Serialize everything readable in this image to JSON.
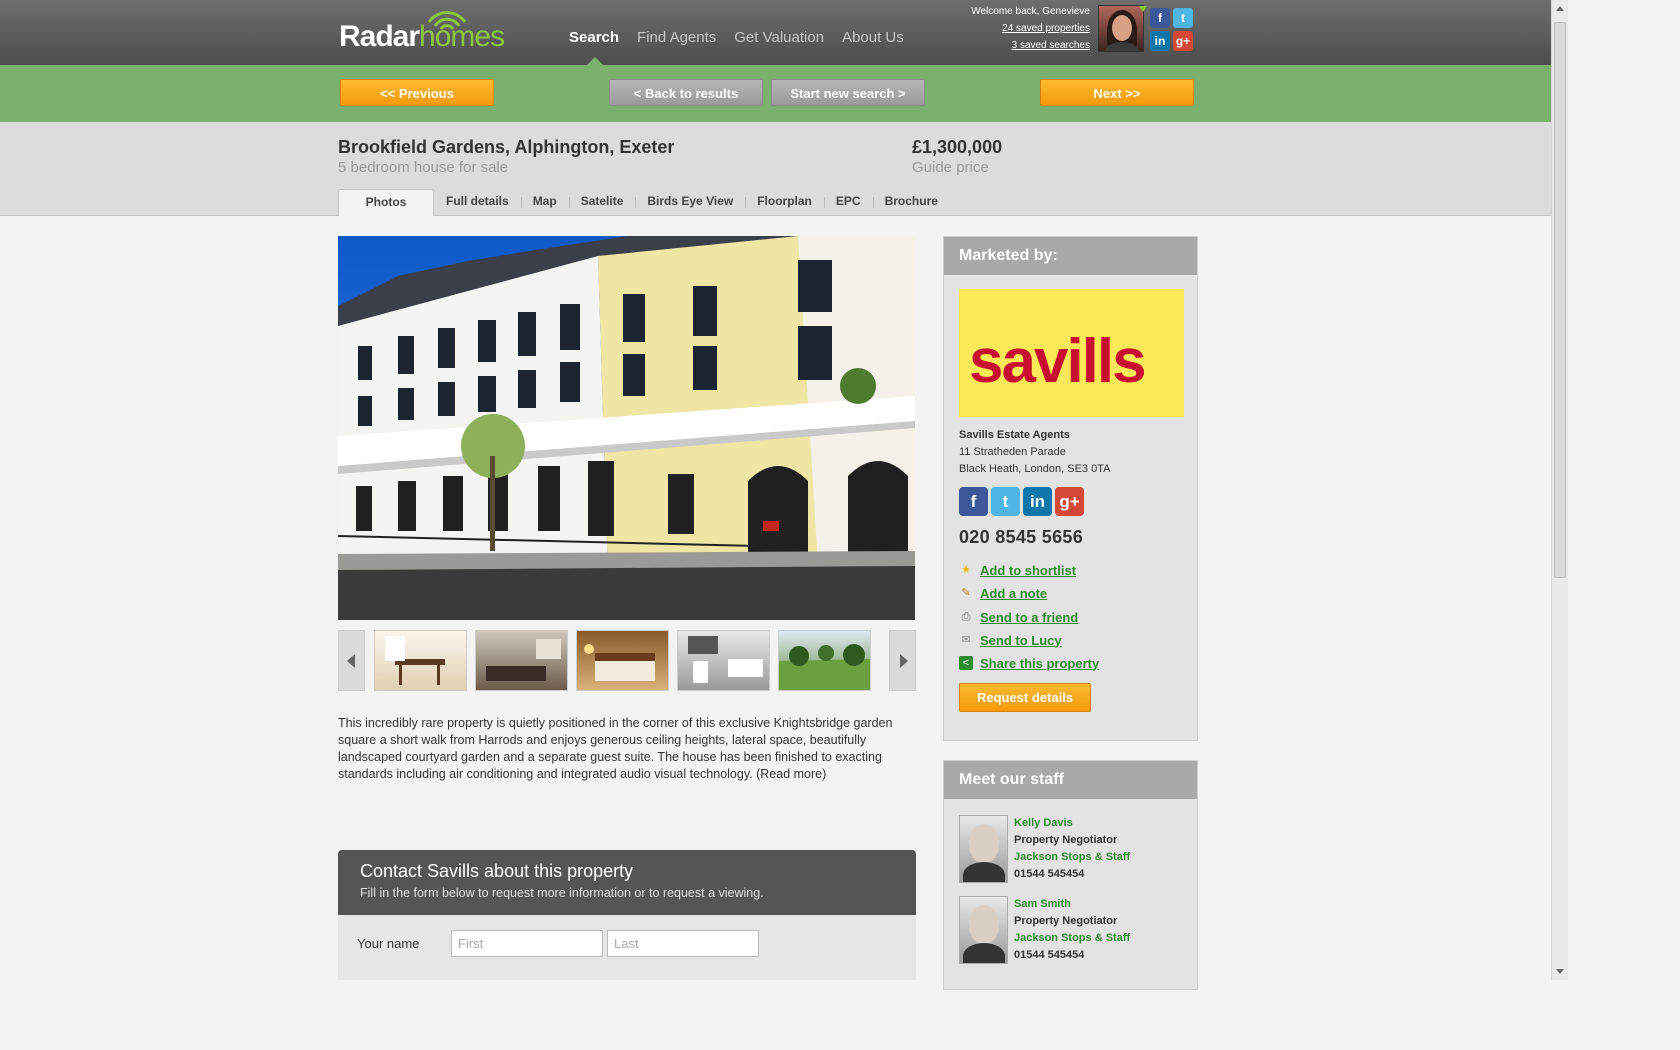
{
  "header": {
    "logo_part1": "Radar",
    "logo_part2": "homes",
    "nav": [
      "Search",
      "Find Agents",
      "Get Valuation",
      "About Us"
    ],
    "welcome": "Welcome back, Genevieve",
    "saved_properties": "24 saved properties",
    "saved_searches": "3 saved searches",
    "social_icons": [
      "facebook-icon",
      "twitter-icon",
      "linkedin-icon",
      "googleplus-icon"
    ]
  },
  "actionbar": {
    "previous": "<< Previous",
    "back_to_results": "< Back to results",
    "start_new_search": "Start new search >",
    "next": "Next >>"
  },
  "property": {
    "title": "Brookfield Gardens, Alphington, Exeter",
    "subtitle": "5 bedroom house for sale",
    "price": "£1,300,000",
    "price_label": "Guide price",
    "tabs": [
      "Photos",
      "Full details",
      "Map",
      "Satelite",
      "Birds Eye View",
      "Floorplan",
      "EPC",
      "Brochure"
    ],
    "description": "This incredibly rare property is quietly positioned in the corner of this exclusive Knightsbridge garden square a short walk from Harrods and enjoys generous ceiling heights, lateral space, beautifully landscaped courtyard garden and a separate guest suite. The house has been finished to exacting standards including air conditioning and integrated audio visual technology. (Read more)"
  },
  "contact": {
    "heading": "Contact Savills about this property",
    "subheading": "Fill in the form below to request more information or to request a viewing.",
    "name_label": "Your name",
    "first_placeholder": "First",
    "last_placeholder": "Last"
  },
  "agent": {
    "panel_title": "Marketed by:",
    "logo_text": "savills",
    "name": "Savills Estate Agents",
    "address1": "11 Stratheden Parade",
    "address2": "Black Heath, London, SE3 0TA",
    "phone": "020 8545 5656",
    "actions": [
      "Add to shortlist",
      "Add a note",
      "Send to a friend",
      "Send to Lucy",
      "Share this property"
    ],
    "request_button": "Request details"
  },
  "staff": {
    "panel_title": "Meet our staff",
    "members": [
      {
        "name": "Kelly Davis",
        "role": "Property Negotiator",
        "company": "Jackson Stops & Staff",
        "phone": "01544 545454"
      },
      {
        "name": "Sam Smith",
        "role": "Property Negotiator",
        "company": "Jackson Stops & Staff",
        "phone": "01544 545454"
      }
    ]
  },
  "colors": {
    "green_bar": "#7bb16e",
    "orange_button": "#f5a414",
    "link_green": "#2e8b2e",
    "savills_yellow": "#fbe95a",
    "savills_red": "#c8102e"
  }
}
